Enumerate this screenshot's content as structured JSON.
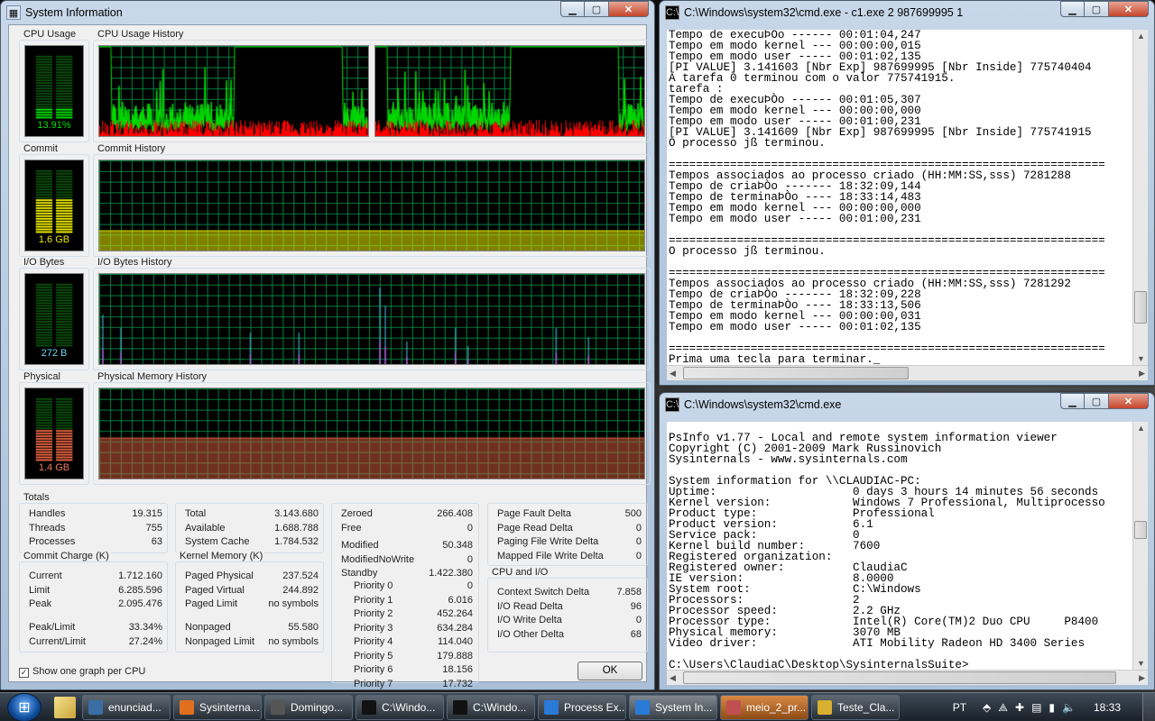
{
  "colors": {
    "cpu": "#00d800",
    "cpuKernel": "#ff0000",
    "commit": "#e8e800",
    "io_read": "#4ec6e8",
    "io_write": "#e83ce8",
    "physical": "#e06040",
    "grid": "#008040"
  },
  "sysinfo": {
    "title": "System Information",
    "labels": {
      "cpu": "CPU Usage",
      "cpu_hist": "CPU Usage History",
      "commit": "Commit",
      "commit_hist": "Commit History",
      "io": "I/O Bytes",
      "io_hist": "I/O Bytes History",
      "phys": "Physical",
      "phys_hist": "Physical Memory History"
    },
    "meters": {
      "cpu": "13.91%",
      "commit": "1.6 GB",
      "io": "272 B",
      "phys": "1.4 GB"
    },
    "levels": {
      "cpu": 0.14,
      "commit": 0.52,
      "io": 0.0,
      "phys": 0.46
    },
    "totals": {
      "title": "Totals",
      "rows": [
        [
          "Handles",
          "19.315"
        ],
        [
          "Threads",
          "755"
        ],
        [
          "Processes",
          "63"
        ]
      ]
    },
    "commit_charge": {
      "title": "Commit Charge (K)",
      "rows": [
        [
          "Current",
          "1.712.160"
        ],
        [
          "Limit",
          "6.285.596"
        ],
        [
          "Peak",
          "2.095.476"
        ]
      ],
      "rows2": [
        [
          "Peak/Limit",
          "33.34%"
        ],
        [
          "Current/Limit",
          "27.24%"
        ]
      ]
    },
    "physical_memory": {
      "rows": [
        [
          "Total",
          "3.143.680"
        ],
        [
          "Available",
          "1.688.788"
        ],
        [
          "System Cache",
          "1.784.532"
        ]
      ]
    },
    "kernel_memory": {
      "title": "Kernel Memory (K)",
      "rows": [
        [
          "Paged Physical",
          "237.524"
        ],
        [
          "Paged Virtual",
          "244.892"
        ],
        [
          "Paged Limit",
          "no symbols"
        ]
      ],
      "rows2": [
        [
          "Nonpaged",
          "55.580"
        ],
        [
          "Nonpaged Limit",
          "no symbols"
        ]
      ]
    },
    "paging_lists": {
      "rows": [
        [
          "Zeroed",
          "266.408"
        ],
        [
          "Free",
          "0"
        ]
      ],
      "rows2": [
        [
          "Modified",
          "50.348"
        ],
        [
          "ModifiedNoWrite",
          "0"
        ],
        [
          "Standby",
          "1.422.380"
        ]
      ],
      "prio": [
        [
          "Priority 0",
          "0"
        ],
        [
          "Priority 1",
          "6.016"
        ],
        [
          "Priority 2",
          "452.264"
        ],
        [
          "Priority 3",
          "634.284"
        ],
        [
          "Priority 4",
          "114.040"
        ],
        [
          "Priority 5",
          "179.888"
        ],
        [
          "Priority 6",
          "18.156"
        ],
        [
          "Priority 7",
          "17.732"
        ]
      ]
    },
    "paging": {
      "rows": [
        [
          "Page Fault Delta",
          "500"
        ],
        [
          "Page Read Delta",
          "0"
        ],
        [
          "Paging File Write Delta",
          "0"
        ],
        [
          "Mapped File Write Delta",
          "0"
        ]
      ]
    },
    "cpu_io": {
      "title": "CPU and I/O",
      "rows": [
        [
          "Context Switch Delta",
          "7.858"
        ],
        [
          "I/O Read Delta",
          "96"
        ],
        [
          "I/O Write Delta",
          "0"
        ],
        [
          "I/O Other Delta",
          "68"
        ]
      ]
    },
    "checkbox": "Show one graph per CPU",
    "ok": "OK"
  },
  "cmd1": {
    "title": "C:\\Windows\\system32\\cmd.exe - c1.exe  2 987699995 1",
    "text": "Tempo de execuÞÒo ------ 00:01:04,247\nTempo em modo kernel --- 00:00:00,015\nTempo em modo user ----- 00:01:02,135\n[PI VALUE] 3.141603 [Nbr Exp] 987699995 [Nbr Inside] 775740404\nA tarefa 0 terminou com o valor 775741915.\ntarefa :\nTempo de execuÞÒo ------ 00:01:05,307\nTempo em modo kernel --- 00:00:00,000\nTempo em modo user ----- 00:01:00,231\n[PI VALUE] 3.141609 [Nbr Exp] 987699995 [Nbr Inside] 775741915\nO processo jß terminou.\n\n================================================================\nTempos associados ao processo criado (HH:MM:SS,sss) 7281288\nTempo de criaÞÒo ------- 18:32:09,144\nTempo de terminaÞÒo ---- 18:33:14,483\nTempo em modo kernel --- 00:00:00,000\nTempo em modo user ----- 00:01:00,231\n\n================================================================\nO processo jß terminou.\n\n================================================================\nTempos associados ao processo criado (HH:MM:SS,sss) 7281292\nTempo de criaÞÒo ------- 18:32:09,228\nTempo de terminaÞÒo ---- 18:33:13,506\nTempo em modo kernel --- 00:00:00,031\nTempo em modo user ----- 00:01:02,135\n\n================================================================\nPrima uma tecla para terminar._"
  },
  "cmd2": {
    "title": "C:\\Windows\\system32\\cmd.exe",
    "text": "PsInfo v1.77 - Local and remote system information viewer\nCopyright (C) 2001-2009 Mark Russinovich\nSysinternals - www.sysinternals.com\n\nSystem information for \\\\CLAUDIAC-PC:\nUptime:                    0 days 3 hours 14 minutes 56 seconds\nKernel version:            Windows 7 Professional, Multiprocesso\nProduct type:              Professional\nProduct version:           6.1\nService pack:              0\nKernel build number:       7600\nRegistered organization:\nRegistered owner:          ClaudiaC\nIE version:                8.0000\nSystem root:               C:\\Windows\nProcessors:                2\nProcessor speed:           2.2 GHz\nProcessor type:            Intel(R) Core(TM)2 Duo CPU     P8400\nPhysical memory:           3070 MB\nVideo driver:              ATI Mobility Radeon HD 3400 Series\n\nC:\\Users\\ClaudiaC\\Desktop\\SysinternalsSuite>"
  },
  "taskbar": {
    "items": [
      "enunciad...",
      "Sysinterna...",
      "Domingo...",
      "C:\\Windo...",
      "C:\\Windo...",
      "Process Ex...",
      "System In...",
      "meio_2_pr...",
      "Teste_Cla..."
    ],
    "lang": "PT",
    "clock": "18:33"
  }
}
